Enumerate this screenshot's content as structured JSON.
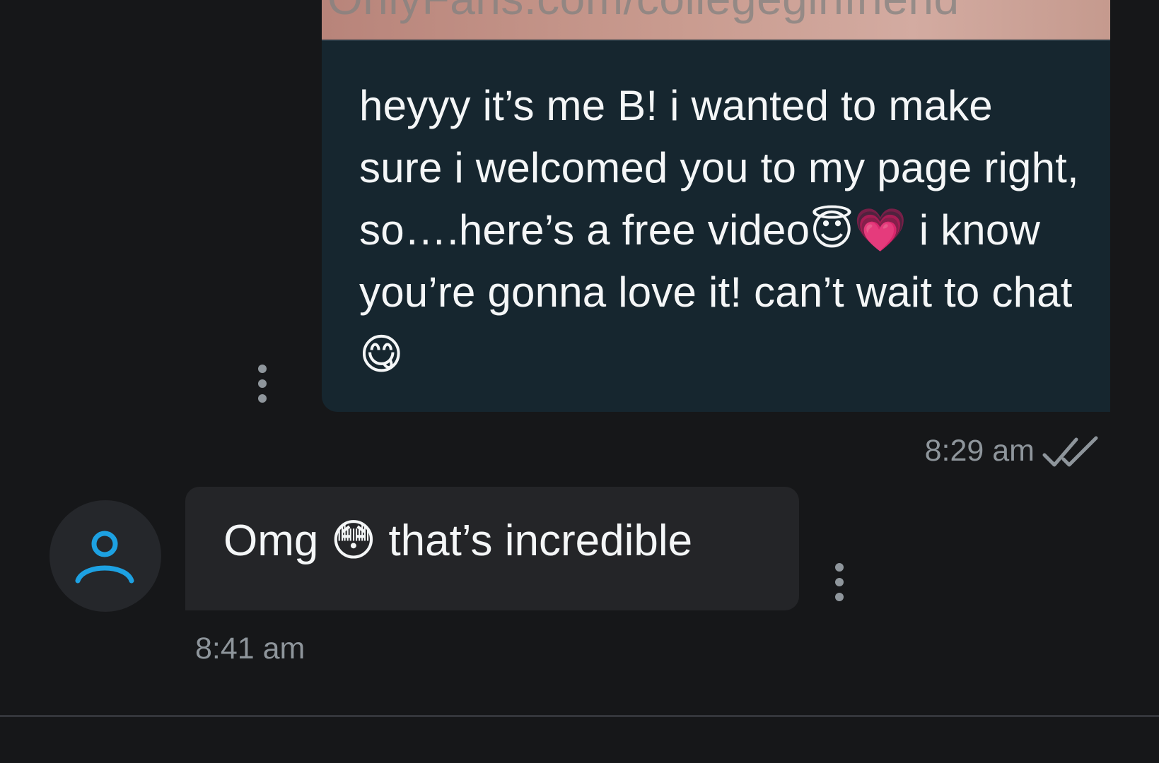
{
  "media": {
    "watermark": "OnlyFans.com/collegegirlfriend"
  },
  "outgoing": {
    "text": "heyyy it’s me B! i wanted to make sure i welcomed you to my page right, so….here’s a free video😇💗 i know you’re gonna love it! can’t wait to chat😋",
    "time": "8:29 am",
    "status_icon": "double-check-icon"
  },
  "incoming": {
    "text": "Omg 😳 that’s incredible",
    "time": "8:41 am",
    "avatar_icon": "user-icon"
  },
  "colors": {
    "background": "#161719",
    "outgoing_bubble": "#16262f",
    "incoming_bubble": "#242528",
    "accent": "#1da1e2",
    "muted_text": "#8e959b"
  }
}
